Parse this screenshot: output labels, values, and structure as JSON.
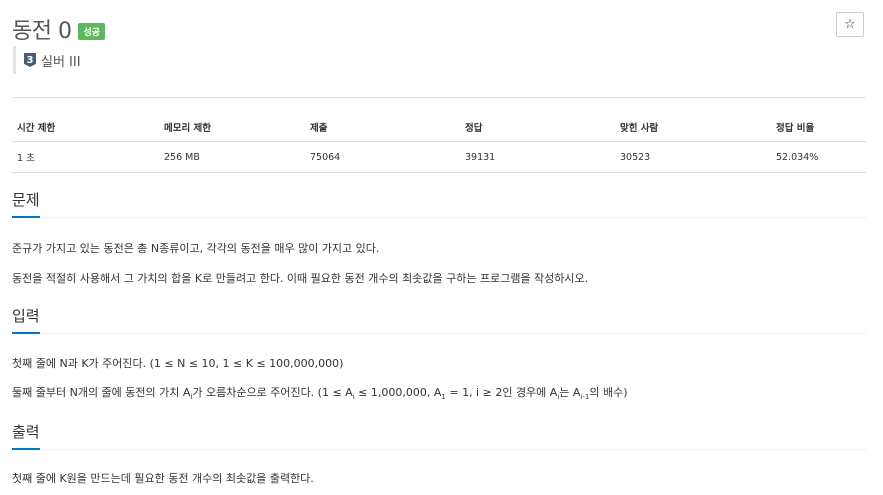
{
  "problem": {
    "title": "동전 0",
    "status_badge": "성공",
    "star": "☆",
    "tier": {
      "number": "3",
      "label": "실버 III"
    }
  },
  "info_table": {
    "headers": [
      "시간 제한",
      "메모리 제한",
      "제출",
      "정답",
      "맞힌 사람",
      "정답 비율"
    ],
    "row": [
      "1 초",
      "256 MB",
      "75064",
      "39131",
      "30523",
      "52.034%"
    ]
  },
  "sections": {
    "description": {
      "heading": "문제",
      "lines": [
        "준규가 가지고 있는 동전은 총 N종류이고, 각각의 동전을 매우 많이 가지고 있다.",
        "동전을 적절히 사용해서 그 가치의 합을 K로 만들려고 한다. 이때 필요한 동전 개수의 최솟값을 구하는 프로그램을 작성하시오."
      ]
    },
    "input": {
      "heading": "입력",
      "line1": "첫째 줄에 N과 K가 주어진다. (1 ≤ N ≤ 10, 1 ≤ K ≤ 100,000,000)",
      "line2": {
        "t1": "둘째 줄부터 N개의 줄에 동전의 가치 A",
        "s1": "i",
        "t2": "가 오름차순으로 주어진다. (1 ≤ A",
        "s2": "i",
        "t3": " ≤ 1,000,000, A",
        "s3": "1",
        "t4": " = 1, i ≥ 2인 경우에 A",
        "s4": "i",
        "t5": "는 A",
        "s5": "i-1",
        "t6": "의 배수)"
      }
    },
    "output": {
      "heading": "출력",
      "lines": [
        "첫째 줄에 K원을 만드는데 필요한 동전 개수의 최솟값을 출력한다."
      ]
    }
  }
}
